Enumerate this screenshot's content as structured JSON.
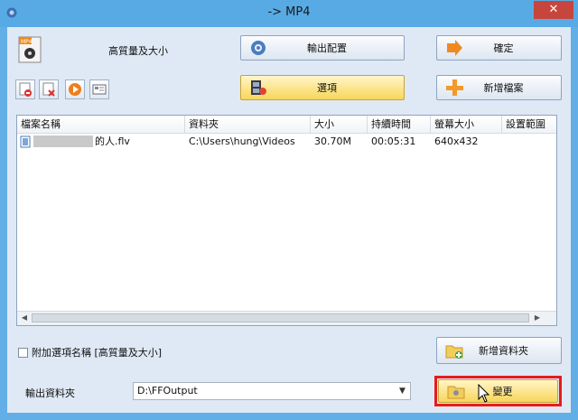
{
  "window": {
    "title": "-> MP4",
    "close_glyph": "✕"
  },
  "profile": {
    "label": "高質量及大小",
    "icon": "mp4-file-icon"
  },
  "buttons": {
    "output_settings": "輸出配置",
    "ok": "確定",
    "options": "選項",
    "add_file": "新增檔案",
    "add_folder": "新增資料夾",
    "change": "變更"
  },
  "list": {
    "columns": [
      "檔案名稱",
      "資料夾",
      "大小",
      "持續時間",
      "螢幕大小",
      "設置範圍"
    ],
    "rows": [
      {
        "filename": "的人.flv",
        "folder": "C:\\Users\\hung\\Videos",
        "size": "30.70M",
        "duration": "00:05:31",
        "screen": "640x432",
        "range": ""
      }
    ]
  },
  "option_checkbox": {
    "label": "附加選項名稱 [高質量及大小]",
    "checked": false
  },
  "output": {
    "label": "輸出資料夾",
    "value": "D:\\FFOutput"
  },
  "colors": {
    "highlight": "#e51c1c",
    "titlebar": "#58aae5",
    "close": "#c6463d"
  }
}
